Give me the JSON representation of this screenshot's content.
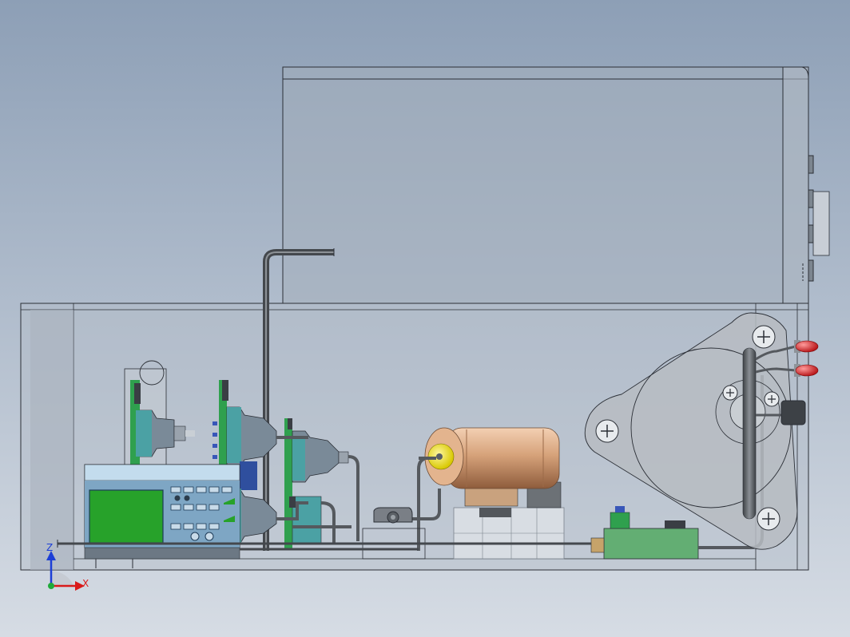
{
  "view": {
    "background_top": "#8d9fb6",
    "background_bottom": "#d6dce4",
    "housing_stroke": "#2b2f36",
    "pipe_color": "#5d6166",
    "lamp_color": "#e8252b",
    "screen_color": "#27a22a",
    "panel_color": "#8ab2cf",
    "pcb_color": "#2fa04e",
    "tube_color": "#d6a27a"
  },
  "triad": {
    "z_label": "Z",
    "x_label": "X",
    "z_color": "#1d3fd6",
    "x_color": "#d91a1a",
    "origin_color": "#1faa3a"
  }
}
